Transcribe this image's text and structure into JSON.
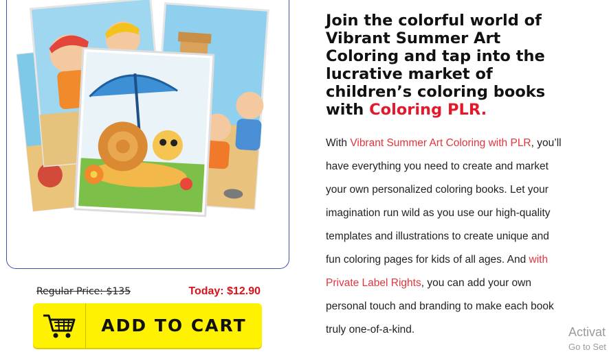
{
  "product": {
    "image_alt": "Vibrant Summer Art Coloring book covers",
    "regular_price": "Regular Price: $135",
    "today_price": "Today: $12.90",
    "cart_icon": "shopping-cart-icon",
    "add_to_cart": "ADD TO CART"
  },
  "headline": {
    "text": "Join the colorful world of Vibrant Summer Art Coloring and tap into the lucrative market of children’s coloring books with ",
    "highlight": "Coloring PLR."
  },
  "body": {
    "p1_before": "With ",
    "p1_link": "Vibrant Summer Art Coloring with PLR",
    "p1_mid": ", you’ll have everything you need to create and market your own personalized coloring books. Let your imagination run wild as you use our high-quality templates and illustrations to create unique and fun coloring pages for kids of all ages. And ",
    "p1_link2": "with Private Label Rights",
    "p1_after": ", you can add your own personal touch and branding to make each book truly one-of-a-kind."
  },
  "overlay": {
    "activate": "Activat",
    "goto": "Go to Set"
  },
  "colors": {
    "accent_red": "#e3192b",
    "button_yellow": "#fff200",
    "card_border": "#3b4fb0"
  }
}
